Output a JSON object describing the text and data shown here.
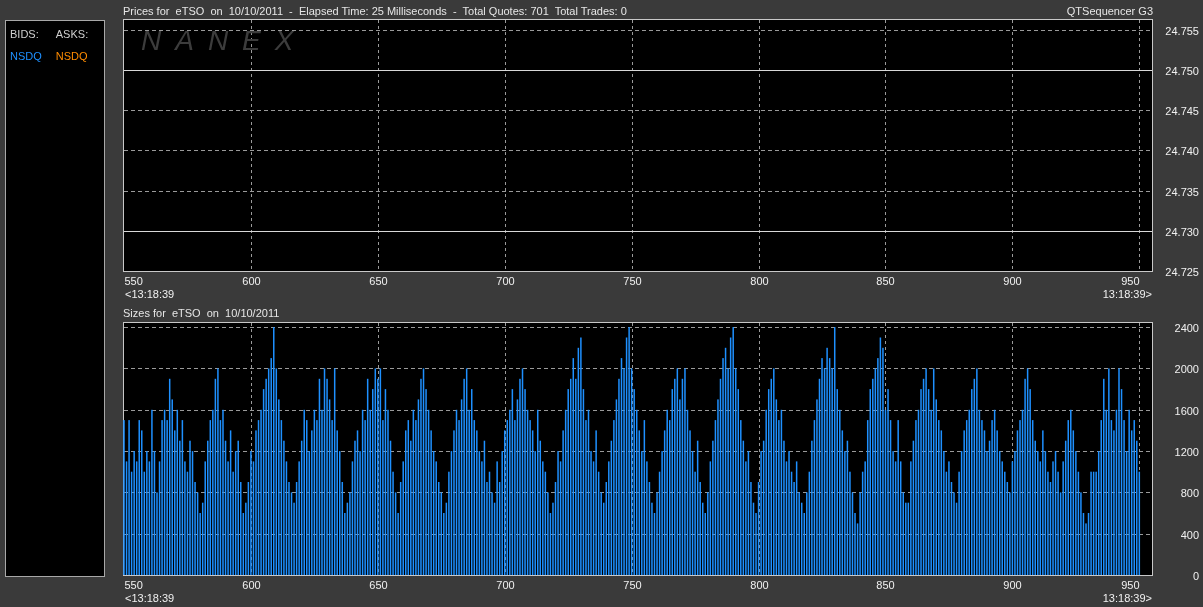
{
  "header": {
    "title": "Prices for  eTSO  on  10/10/2011  -  Elapsed Time: 25 Milliseconds  -  Total Quotes: 701  Total Trades: 0",
    "app_name": "QTSequencer G3"
  },
  "legend": {
    "columns": [
      {
        "label": "BIDS:",
        "items": [
          {
            "text": "NSDQ",
            "color": "#1e90ff"
          }
        ]
      },
      {
        "label": "ASKS:",
        "items": [
          {
            "text": "NSDQ",
            "color": "#ff8c00"
          }
        ]
      }
    ]
  },
  "price_chart": {
    "logo": "NANEX",
    "start_time": "<13:18:39",
    "end_time": "13:18:39>",
    "chart_data": {
      "type": "line",
      "xlim": [
        550,
        955
      ],
      "ylim": [
        24.725,
        24.7562
      ],
      "xticks": [
        550,
        600,
        650,
        700,
        750,
        800,
        850,
        900,
        950
      ],
      "yticks": [
        {
          "value": 24.725,
          "label": "24.725"
        },
        {
          "value": 24.73,
          "label": "24.730"
        },
        {
          "value": 24.735,
          "label": "24.735"
        },
        {
          "value": 24.74,
          "label": "24.740"
        },
        {
          "value": 24.745,
          "label": "24.745"
        },
        {
          "value": 24.75,
          "label": "24.750"
        },
        {
          "value": 24.755,
          "label": "24.755"
        }
      ],
      "grid": true,
      "x": [
        550,
        955
      ],
      "series": [
        {
          "color": "#d8d8d8",
          "values": [
            24.75,
            24.75
          ]
        },
        {
          "color": "#d8d8d8",
          "values": [
            24.73,
            24.73
          ]
        }
      ]
    }
  },
  "size_chart": {
    "title": "Sizes for  eTSO  on  10/10/2011",
    "start_time": "<13:18:39",
    "end_time": "13:18:39>",
    "chart_data": {
      "type": "bar",
      "xlim": [
        550,
        955
      ],
      "ylim": [
        0,
        2440
      ],
      "xticks": [
        550,
        600,
        650,
        700,
        750,
        800,
        850,
        900,
        950
      ],
      "yticks": [
        0,
        400,
        800,
        1200,
        1600,
        2000,
        2400
      ],
      "grid": true,
      "x": [
        550,
        551,
        552,
        553,
        554,
        555,
        556,
        557,
        558,
        559,
        560,
        561,
        562,
        563,
        564,
        565,
        566,
        567,
        568,
        569,
        570,
        571,
        572,
        573,
        574,
        575,
        576,
        577,
        578,
        579,
        580,
        581,
        582,
        583,
        584,
        585,
        586,
        587,
        588,
        589,
        590,
        591,
        592,
        593,
        594,
        595,
        596,
        597,
        598,
        599,
        600,
        601,
        602,
        603,
        604,
        605,
        606,
        607,
        608,
        609,
        610,
        611,
        612,
        613,
        614,
        615,
        616,
        617,
        618,
        619,
        620,
        621,
        622,
        623,
        624,
        625,
        626,
        627,
        628,
        629,
        630,
        631,
        632,
        633,
        634,
        635,
        636,
        637,
        638,
        639,
        640,
        641,
        642,
        643,
        644,
        645,
        646,
        647,
        648,
        649,
        650,
        651,
        652,
        653,
        654,
        655,
        656,
        657,
        658,
        659,
        660,
        661,
        662,
        663,
        664,
        665,
        666,
        667,
        668,
        669,
        670,
        671,
        672,
        673,
        674,
        675,
        676,
        677,
        678,
        679,
        680,
        681,
        682,
        683,
        684,
        685,
        686,
        687,
        688,
        689,
        690,
        691,
        692,
        693,
        694,
        695,
        696,
        697,
        698,
        699,
        700,
        701,
        702,
        703,
        704,
        705,
        706,
        707,
        708,
        709,
        710,
        711,
        712,
        713,
        714,
        715,
        716,
        717,
        718,
        719,
        720,
        721,
        722,
        723,
        724,
        725,
        726,
        727,
        728,
        729,
        730,
        731,
        732,
        733,
        734,
        735,
        736,
        737,
        738,
        739,
        740,
        741,
        742,
        743,
        744,
        745,
        746,
        747,
        748,
        749,
        750,
        751,
        752,
        753,
        754,
        755,
        756,
        757,
        758,
        759,
        760,
        761,
        762,
        763,
        764,
        765,
        766,
        767,
        768,
        769,
        770,
        771,
        772,
        773,
        774,
        775,
        776,
        777,
        778,
        779,
        780,
        781,
        782,
        783,
        784,
        785,
        786,
        787,
        788,
        789,
        790,
        791,
        792,
        793,
        794,
        795,
        796,
        797,
        798,
        799,
        800,
        801,
        802,
        803,
        804,
        805,
        806,
        807,
        808,
        809,
        810,
        811,
        812,
        813,
        814,
        815,
        816,
        817,
        818,
        819,
        820,
        821,
        822,
        823,
        824,
        825,
        826,
        827,
        828,
        829,
        830,
        831,
        832,
        833,
        834,
        835,
        836,
        837,
        838,
        839,
        840,
        841,
        842,
        843,
        844,
        845,
        846,
        847,
        848,
        849,
        850,
        851,
        852,
        853,
        854,
        855,
        856,
        857,
        858,
        859,
        860,
        861,
        862,
        863,
        864,
        865,
        866,
        867,
        868,
        869,
        870,
        871,
        872,
        873,
        874,
        875,
        876,
        877,
        878,
        879,
        880,
        881,
        882,
        883,
        884,
        885,
        886,
        887,
        888,
        889,
        890,
        891,
        892,
        893,
        894,
        895,
        896,
        897,
        898,
        899,
        900,
        901,
        902,
        903,
        904,
        905,
        906,
        907,
        908,
        909,
        910,
        911,
        912,
        913,
        914,
        915,
        916,
        917,
        918,
        919,
        920,
        921,
        922,
        923,
        924,
        925,
        926,
        927,
        928,
        929,
        930,
        931,
        932,
        933,
        934,
        935,
        936,
        937,
        938,
        939,
        940,
        941,
        942,
        943,
        944,
        945,
        946,
        947,
        948,
        949,
        950
      ],
      "series": [
        {
          "color": "#1e90ff",
          "values": [
            1500,
            1100,
            1500,
            1000,
            1200,
            1100,
            1500,
            1400,
            1000,
            1200,
            1100,
            1600,
            1200,
            800,
            1100,
            1500,
            1600,
            1500,
            1900,
            1700,
            1400,
            1600,
            1300,
            1500,
            1100,
            1000,
            1300,
            1200,
            900,
            800,
            600,
            700,
            1100,
            1300,
            1500,
            1600,
            1900,
            2000,
            1500,
            1600,
            1300,
            1100,
            1400,
            1000,
            1200,
            1300,
            900,
            600,
            700,
            900,
            1200,
            1100,
            1400,
            1500,
            1600,
            1800,
            1900,
            2000,
            2100,
            2400,
            2000,
            1700,
            1500,
            1300,
            1100,
            900,
            800,
            700,
            900,
            1100,
            1300,
            1600,
            1500,
            1200,
            1400,
            1600,
            1500,
            1900,
            1600,
            2000,
            1900,
            1700,
            1500,
            2000,
            1400,
            1200,
            900,
            600,
            700,
            800,
            1100,
            1300,
            1400,
            1200,
            1600,
            1500,
            1900,
            1600,
            1800,
            2000,
            1900,
            2000,
            1500,
            1800,
            1600,
            1300,
            1000,
            800,
            600,
            900,
            1100,
            1400,
            1500,
            1300,
            1600,
            1500,
            1700,
            1900,
            2000,
            1800,
            1600,
            1400,
            1200,
            1100,
            900,
            800,
            600,
            700,
            1000,
            1200,
            1400,
            1600,
            1500,
            1700,
            1900,
            2000,
            1600,
            1800,
            1500,
            1400,
            1200,
            1100,
            1300,
            900,
            1000,
            800,
            700,
            1100,
            900,
            1200,
            1400,
            1500,
            1600,
            1800,
            1500,
            1700,
            1900,
            2000,
            1800,
            1600,
            1500,
            1400,
            1200,
            1600,
            1300,
            1100,
            1000,
            800,
            600,
            700,
            900,
            1200,
            1100,
            1400,
            1600,
            1800,
            1900,
            2100,
            1900,
            2200,
            2300,
            1800,
            1500,
            1600,
            1200,
            1100,
            1400,
            1000,
            800,
            700,
            900,
            1100,
            1300,
            1500,
            1700,
            1900,
            2100,
            2000,
            2300,
            2400,
            2000,
            1800,
            1600,
            1400,
            1200,
            1500,
            1100,
            900,
            700,
            600,
            800,
            1000,
            1200,
            1400,
            1600,
            1500,
            1800,
            1900,
            2000,
            1700,
            1900,
            2000,
            1600,
            1400,
            1200,
            1000,
            1300,
            900,
            700,
            600,
            800,
            1100,
            1300,
            1500,
            1700,
            1900,
            2100,
            2200,
            2000,
            2300,
            2400,
            2000,
            1800,
            1500,
            1300,
            1100,
            1200,
            900,
            700,
            600,
            900,
            1200,
            1300,
            1600,
            1800,
            1900,
            2000,
            1700,
            1500,
            1600,
            1300,
            1100,
            1200,
            1000,
            900,
            1100,
            800,
            700,
            600,
            800,
            1000,
            1300,
            1500,
            1700,
            1900,
            2100,
            2000,
            2200,
            2100,
            2000,
            2400,
            1800,
            1600,
            1400,
            1200,
            1300,
            1000,
            800,
            600,
            500,
            800,
            1000,
            1100,
            1500,
            1800,
            1900,
            2000,
            2100,
            2300,
            2200,
            1600,
            1800,
            1500,
            1200,
            1100,
            1500,
            1100,
            800,
            700,
            700,
            1100,
            1300,
            1500,
            1600,
            1800,
            1900,
            2000,
            1800,
            1600,
            2000,
            1700,
            1500,
            1400,
            1200,
            1000,
            1100,
            900,
            800,
            700,
            1000,
            1200,
            1400,
            1500,
            1600,
            1800,
            1900,
            2000,
            1600,
            1500,
            1400,
            1200,
            1300,
            1500,
            1600,
            1400,
            1200,
            1100,
            1000,
            900,
            800,
            1100,
            1200,
            1400,
            1500,
            1600,
            1900,
            2000,
            1800,
            1500,
            1300,
            1200,
            1100,
            1400,
            1200,
            1000,
            900,
            1100,
            1200,
            1000,
            800,
            1100,
            1300,
            1500,
            1600,
            1400,
            1200,
            1000,
            800,
            600,
            500,
            600,
            1000,
            1000,
            1000,
            1200,
            1500,
            1900,
            1600,
            2000,
            1500,
            1400,
            1600,
            2000,
            1800,
            1500,
            1200,
            1600,
            1400,
            1500,
            1300,
            1000
          ]
        }
      ]
    }
  }
}
